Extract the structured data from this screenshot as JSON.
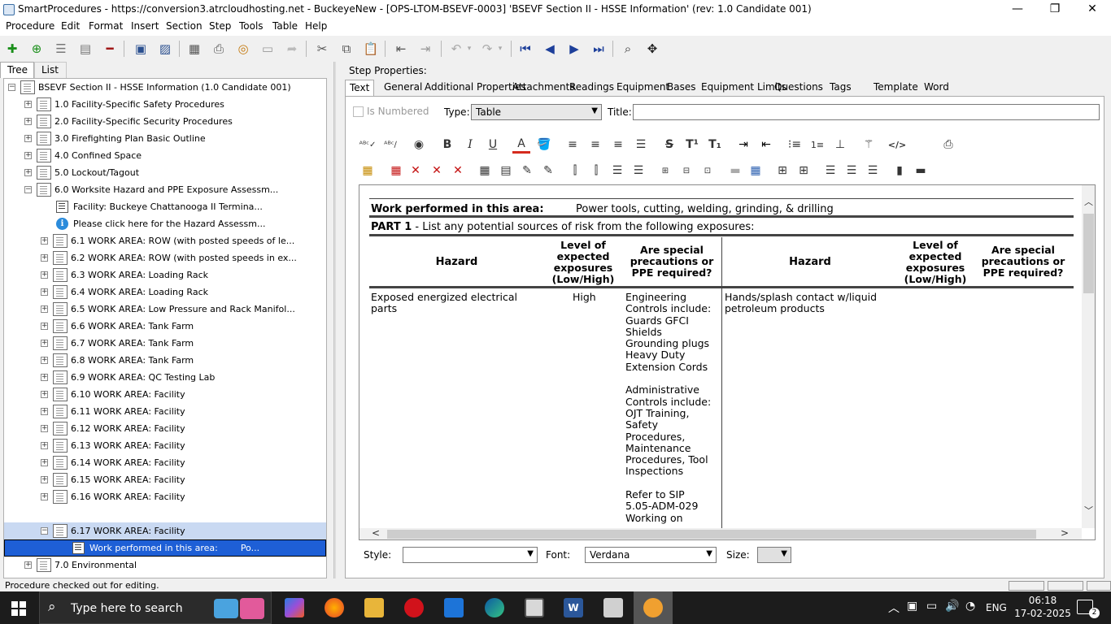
{
  "window": {
    "title": "SmartProcedures - https://conversion3.atrcloudhosting.net - BuckeyeNew - [OPS-LTOM-BSEVF-0003] 'BSEVF Section II - HSSE Information' (rev: 1.0 Candidate 001)",
    "minimize": "—",
    "restore": "❐",
    "close": "✕"
  },
  "menu": [
    "Procedure",
    "Edit",
    "Format",
    "Insert",
    "Section",
    "Step",
    "Tools",
    "Table",
    "Help"
  ],
  "left_tabs": [
    "Tree",
    "List"
  ],
  "tree": {
    "root": "BSEVF Section II - HSSE Information (1.0 Candidate 001)",
    "sections": [
      "1.0 Facility-Specific Safety Procedures",
      "2.0 Facility-Specific Security Procedures",
      "3.0 Firefighting Plan Basic Outline",
      "4.0 Confined Space",
      "5.0 Lockout/Tagout",
      "6.0 Worksite Hazard and PPE Exposure Assessm..."
    ],
    "section6_steps": [
      "Facility: Buckeye Chattanooga II Termina...",
      "Please click here for the Hazard Assessm..."
    ],
    "work_areas": [
      "6.1 WORK AREA: ROW (with posted speeds of le...",
      "6.2 WORK AREA: ROW (with posted speeds in ex...",
      "6.3 WORK AREA: Loading Rack",
      "6.4 WORK AREA: Loading Rack",
      "6.5 WORK AREA: Low Pressure and Rack Manifol...",
      "6.6 WORK AREA: Tank Farm",
      "6.7 WORK AREA: Tank Farm",
      "6.8 WORK AREA: Tank Farm",
      "6.9 WORK AREA: QC Testing Lab",
      "6.10 WORK AREA: Facility",
      "6.11 WORK AREA: Facility",
      "6.12 WORK AREA: Facility",
      "6.13 WORK AREA: Facility",
      "6.14 WORK AREA: Facility",
      "6.15 WORK AREA: Facility",
      "6.16 WORK AREA: Facility",
      "6.17 WORK AREA: Facility"
    ],
    "selected_step": "Work performed in this area:        Po...",
    "last_section": "7.0 Environmental"
  },
  "status": "Procedure checked out for editing.",
  "step_properties": {
    "label": "Step Properties:",
    "tabs": [
      "Text",
      "General",
      "Additional Properties",
      "Attachments",
      "Readings",
      "Equipment",
      "Bases",
      "Equipment Limits",
      "Questions",
      "Tags",
      "Template",
      "Word"
    ],
    "is_numbered": "Is Numbered",
    "type_label": "Type:",
    "type_value": "Table",
    "title_label": "Title:",
    "title_value": ""
  },
  "document": {
    "work_label": "Work performed in this area:",
    "work_value": "Power tools, cutting, welding, grinding, & drilling",
    "part1_bold": "PART 1",
    "part1_text": " - List any potential sources of risk from the following exposures:",
    "headers": {
      "hazard": "Hazard",
      "level": "Level of expected exposures (Low/High)",
      "ppe": "Are special precautions or PPE required?"
    },
    "row1": {
      "hazard": "Exposed energized electrical parts",
      "level": "High",
      "ppe_lines": [
        "Engineering",
        "Controls include:",
        "Guards GFCI",
        "Shields",
        "Grounding plugs",
        "Heavy Duty",
        "Extension Cords",
        "",
        "Administrative",
        "Controls include:",
        "OJT Training,",
        "Safety",
        "Procedures,",
        "Maintenance",
        "Procedures, Tool",
        "Inspections",
        "",
        "Refer to SIP",
        "5.05-ADM-029",
        "Working on"
      ],
      "hazard2": "Hands/splash contact w/liquid petroleum products"
    }
  },
  "format_bar": {
    "style_label": "Style:",
    "style_value": "",
    "font_label": "Font:",
    "font_value": "Verdana",
    "size_label": "Size:",
    "size_value": ""
  },
  "taskbar": {
    "search_placeholder": "Type here to search",
    "language": "ENG",
    "time": "06:18",
    "date": "17-02-2025",
    "notifications": "2"
  }
}
